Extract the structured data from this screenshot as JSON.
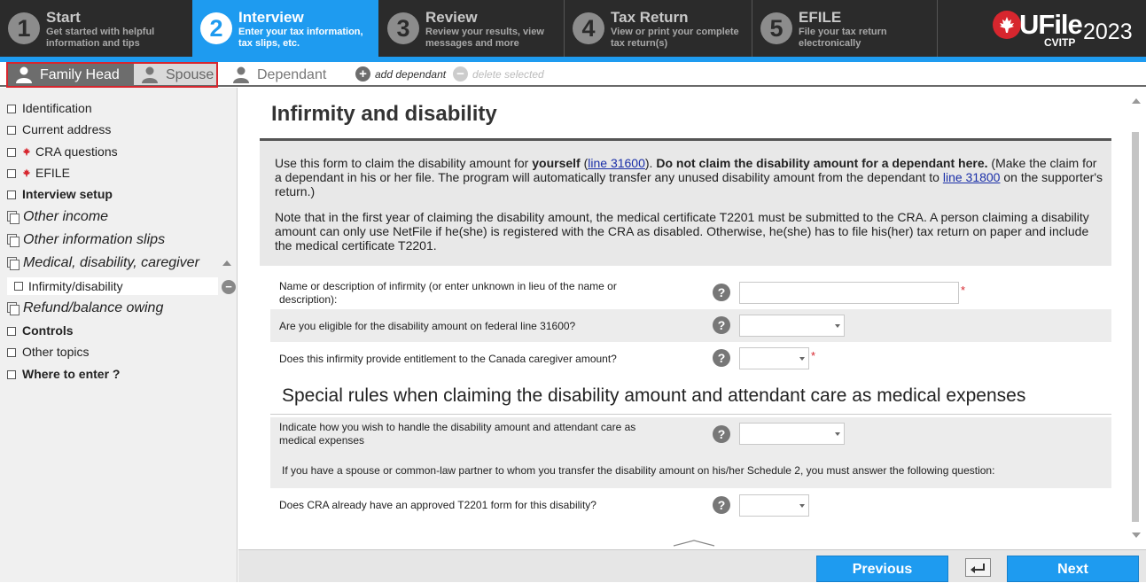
{
  "steps": [
    {
      "num": "1",
      "title": "Start",
      "desc": "Get started with helpful information and tips"
    },
    {
      "num": "2",
      "title": "Interview",
      "desc": "Enter your tax information, tax slips, etc."
    },
    {
      "num": "3",
      "title": "Review",
      "desc": "Review your results, view messages and more"
    },
    {
      "num": "4",
      "title": "Tax Return",
      "desc": "View or print your complete tax return(s)"
    },
    {
      "num": "5",
      "title": "EFILE",
      "desc": "File your tax return electronically"
    }
  ],
  "logo": {
    "brand": "UFile",
    "sub": "CVITP",
    "year": "2023"
  },
  "person_tabs": {
    "family_head": "Family Head",
    "spouse": "Spouse",
    "dependant": "Dependant",
    "add": "add dependant",
    "delete": "delete selected"
  },
  "sidebar": {
    "identification": "Identification",
    "current_address": "Current address",
    "cra_questions": "CRA questions",
    "efile": "EFILE",
    "interview_setup": "Interview setup",
    "other_income": "Other income",
    "other_info_slips": "Other information slips",
    "medical": "Medical, disability, caregiver",
    "infirmity": "Infirmity/disability",
    "refund": "Refund/balance owing",
    "controls": "Controls",
    "other_topics": "Other topics",
    "where_to_enter": "Where to enter ?"
  },
  "main": {
    "title": "Infirmity and disability",
    "p1_a": "Use this form to claim the disability amount for ",
    "p1_b": "yourself",
    "p1_c": " (",
    "p1_link1": "line 31600",
    "p1_d": "). ",
    "p1_e": "Do not claim the disability amount for a dependant here.",
    "p1_f": " (Make the claim for a dependant in his or her file. The program will automatically transfer any unused disability amount from the dependant to ",
    "p1_link2": "line 31800",
    "p1_g": " on the supporter's return.)",
    "p2": "Note that in the first year of claiming the disability amount, the medical certificate T2201 must be submitted to the CRA. A person claiming a disability amount can only use NetFile if he(she) is registered with the CRA as disabled. Otherwise, he(she) has to file his(her) tax return on paper and include the medical certificate T2201.",
    "q1": "Name or description of infirmity (or enter unknown in lieu of the name or description):",
    "q2": "Are you eligible for the disability amount on federal line 31600?",
    "q3": "Does this infirmity provide entitlement to the Canada caregiver amount?",
    "section_title": "Special rules when claiming the disability amount and attendant care as medical expenses",
    "q4": "Indicate how you wish to handle the disability amount and attendant care as medical expenses",
    "notice": "If you have a spouse or common-law partner to whom you transfer the disability amount on his/her Schedule 2, you must answer the following question:",
    "q5": "Does CRA already have an approved T2201 form for this disability?",
    "help": "?",
    "required": "*"
  },
  "nav": {
    "previous": "Previous",
    "next": "Next"
  },
  "colors": {
    "accent": "#1e9bf0",
    "topbar": "#2b2b2b",
    "required": "#d7262e"
  }
}
